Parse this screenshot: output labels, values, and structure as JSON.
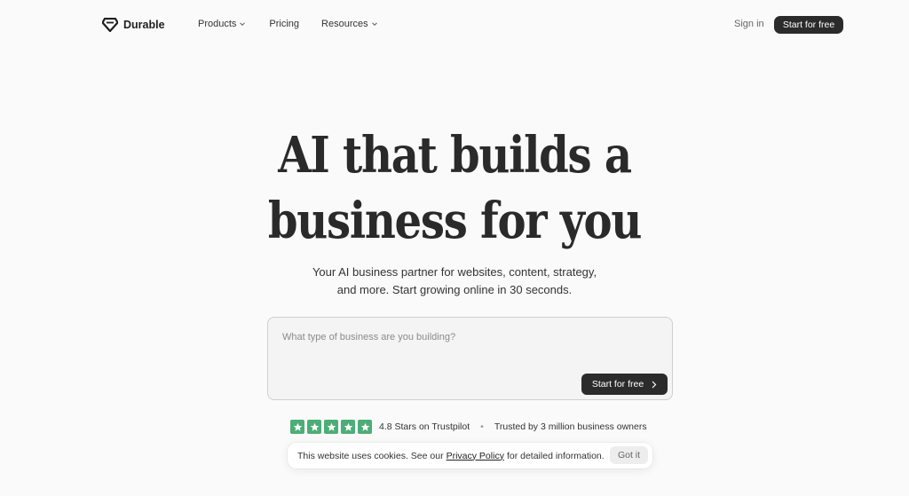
{
  "header": {
    "brand": "Durable",
    "nav": [
      {
        "label": "Products",
        "has_dropdown": true
      },
      {
        "label": "Pricing",
        "has_dropdown": false
      },
      {
        "label": "Resources",
        "has_dropdown": true
      }
    ],
    "sign_in": "Sign in",
    "cta": "Start for free"
  },
  "hero": {
    "title_line1": "AI that builds a",
    "title_line2": "business for you",
    "subtitle_line1": "Your AI business partner for websites, content, strategy,",
    "subtitle_line2": "and more. Start growing online in 30 seconds."
  },
  "prompt": {
    "placeholder": "What type of business are you building?",
    "value": "",
    "button": "Start for free"
  },
  "trust": {
    "stars": 5,
    "rating_text": "4.8 Stars on Trustpilot",
    "separator": "•",
    "trusted_text": "Trusted by 3 million business owners"
  },
  "cookie": {
    "text_before": "This website uses cookies. See our",
    "link": "Privacy Policy",
    "text_after": "for detailed information.",
    "button": "Got it"
  },
  "colors": {
    "background": "#fafafa",
    "button_dark": "#2b2b2b",
    "trustpilot_green": "#4cae77"
  }
}
